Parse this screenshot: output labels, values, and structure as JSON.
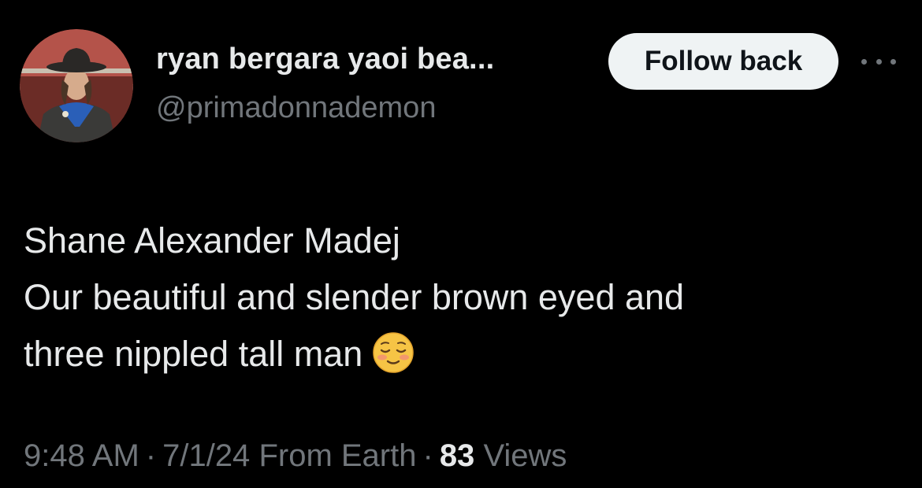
{
  "author": {
    "display_name": "ryan bergara yaoi bea...",
    "handle": "@primadonnademon",
    "avatar_icon": "profile-photo"
  },
  "actions": {
    "follow_label": "Follow back",
    "more_icon": "more-horizontal-icon"
  },
  "tweet": {
    "lines": [
      "Shane Alexander Madej",
      "Our beautiful and slender brown eyed and",
      "three nippled tall man"
    ],
    "emoji": "relieved-face-emoji"
  },
  "meta": {
    "time": "9:48 AM",
    "separator": "·",
    "date": "7/1/24",
    "source": "From Earth",
    "views_count": "83",
    "views_label": "Views"
  },
  "colors": {
    "background": "#000000",
    "text_primary": "#e7e9ea",
    "text_secondary": "#71767b",
    "button_bg": "#eff3f4",
    "button_text": "#0f1419"
  }
}
